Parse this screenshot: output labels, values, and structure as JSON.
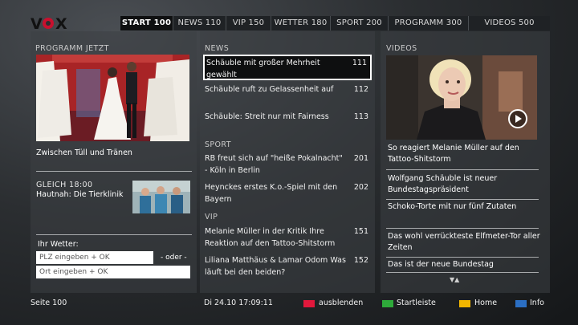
{
  "brand": {
    "logo_text": "VOX"
  },
  "nav": {
    "tabs": [
      {
        "label": "START 100"
      },
      {
        "label": "NEWS 110"
      },
      {
        "label": "VIP 150"
      },
      {
        "label": "WETTER 180"
      },
      {
        "label": "SPORT 200"
      },
      {
        "label": "PROGRAMM 300"
      },
      {
        "label": "VIDEOS 500"
      }
    ]
  },
  "programm": {
    "heading": "PROGRAMM JETZT",
    "now_title": "Zwischen Tüll und Tränen",
    "next_time": "GLEICH 18:00",
    "next_title": "Hautnah: Die Tierklinik"
  },
  "weather": {
    "heading": "Ihr Wetter:",
    "plz_placeholder": "PLZ eingeben + OK",
    "or_label": "- oder -",
    "city_placeholder": "Ort eingeben + OK"
  },
  "news": {
    "heading": "NEWS",
    "items": [
      {
        "title": "Schäuble mit großer Mehrheit gewählt",
        "page": "111"
      },
      {
        "title": "Schäuble ruft zu Gelassenheit auf",
        "page": "112"
      },
      {
        "title": "Schäuble: Streit nur mit Fairness",
        "page": "113"
      }
    ]
  },
  "sport": {
    "heading": "SPORT",
    "items": [
      {
        "title": "RB freut sich auf \"heiße Pokalnacht\" - Köln in Berlin",
        "page": "201"
      },
      {
        "title": "Heynckes erstes K.o.-Spiel mit den Bayern",
        "page": "202"
      }
    ]
  },
  "vip": {
    "heading": "VIP",
    "items": [
      {
        "title": "Melanie Müller in der Kritik Ihre Reaktion auf den Tattoo-Shitstorm",
        "page": "151"
      },
      {
        "title": "Liliana Matthäus & Lamar Odom Was läuft bei den beiden?",
        "page": "152"
      }
    ]
  },
  "videos": {
    "heading": "VIDEOS",
    "items": [
      {
        "title": "So reagiert Melanie Müller auf den Tattoo-Shitstorm"
      },
      {
        "title": "Wolfgang Schäuble ist neuer Bundestagspräsident"
      },
      {
        "title": "Schoko-Torte mit nur fünf Zutaten"
      },
      {
        "title": "Das wohl verrückteste Elfmeter-Tor aller Zeiten"
      },
      {
        "title": "Das ist der neue Bundestag"
      }
    ],
    "scroll_arrows": "▼▲"
  },
  "footer": {
    "page_label": "Seite 100",
    "datetime": "Di 24.10 17:09:11",
    "keys": [
      {
        "label": "ausblenden",
        "color": "#e2183c"
      },
      {
        "label": "Startleiste",
        "color": "#2eaa3a"
      },
      {
        "label": "Home",
        "color": "#f2b600"
      },
      {
        "label": "Info",
        "color": "#2b6fc4"
      }
    ]
  }
}
